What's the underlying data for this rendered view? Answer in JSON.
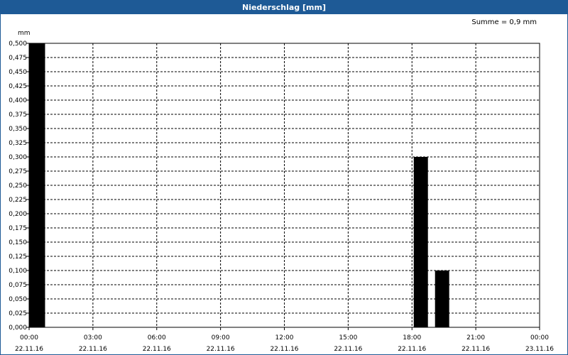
{
  "window": {
    "title": "Niederschlag [mm]"
  },
  "summary": {
    "text": "Summe = 0,9 mm"
  },
  "chart_data": {
    "type": "bar",
    "title": "Niederschlag [mm]",
    "ylabel": "mm",
    "ylim": [
      0,
      0.5
    ],
    "y_ticks": [
      "0,000",
      "0,025",
      "0,050",
      "0,075",
      "0,100",
      "0,125",
      "0,150",
      "0,175",
      "0,200",
      "0,225",
      "0,250",
      "0,275",
      "0,300",
      "0,325",
      "0,350",
      "0,375",
      "0,400",
      "0,425",
      "0,450",
      "0,475",
      "0,500"
    ],
    "x_ticks": [
      {
        "time": "00:00",
        "date": "22.11.16"
      },
      {
        "time": "03:00",
        "date": "22.11.16"
      },
      {
        "time": "06:00",
        "date": "22.11.16"
      },
      {
        "time": "09:00",
        "date": "22.11.16"
      },
      {
        "time": "12:00",
        "date": "22.11.16"
      },
      {
        "time": "15:00",
        "date": "22.11.16"
      },
      {
        "time": "18:00",
        "date": "22.11.16"
      },
      {
        "time": "21:00",
        "date": "22.11.16"
      },
      {
        "time": "00:00",
        "date": "23.11.16"
      }
    ],
    "xlim": [
      "22.11.16 00:00",
      "23.11.16 00:00"
    ],
    "bars": [
      {
        "start": "22.11.16 00:00",
        "end": "22.11.16 00:45",
        "value": 0.5
      },
      {
        "start": "22.11.16 18:05",
        "end": "22.11.16 18:45",
        "value": 0.3
      },
      {
        "start": "22.11.16 19:05",
        "end": "22.11.16 19:45",
        "value": 0.1
      }
    ],
    "grid": true,
    "bar_color": "#000000"
  }
}
